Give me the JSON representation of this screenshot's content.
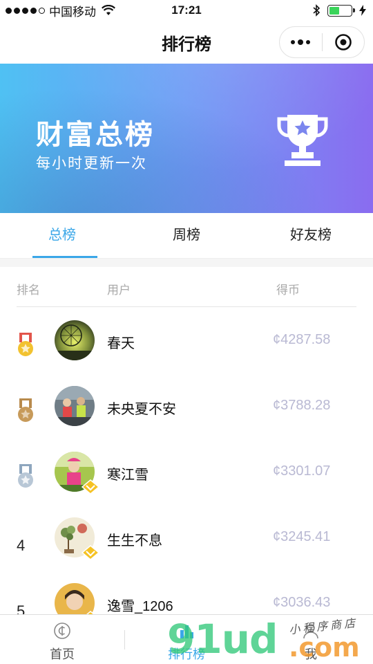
{
  "status_bar": {
    "carrier": "中国移动",
    "time": "17:21",
    "battery_level": 0.45
  },
  "nav": {
    "title": "排行榜"
  },
  "banner": {
    "title": "财富总榜",
    "subtitle": "每小时更新一次",
    "icon": "trophy-icon"
  },
  "tabs": [
    {
      "label": "总榜",
      "active": true
    },
    {
      "label": "周榜",
      "active": false
    },
    {
      "label": "好友榜",
      "active": false
    }
  ],
  "table": {
    "headers": {
      "rank": "排名",
      "user": "用户",
      "coins": "得币"
    },
    "rows": [
      {
        "rank": "1",
        "medal": "gold",
        "name": "春天",
        "coins": "¢4287.58",
        "vip": false
      },
      {
        "rank": "2",
        "medal": "bronze",
        "name": "未央夏不安",
        "coins": "¢3788.28",
        "vip": false
      },
      {
        "rank": "3",
        "medal": "silver",
        "name": "寒江雪",
        "coins": "¢3301.07",
        "vip": true
      },
      {
        "rank": "4",
        "medal": "",
        "name": "生生不息",
        "coins": "¢3245.41",
        "vip": true
      },
      {
        "rank": "5",
        "medal": "",
        "name": "逸雪_1206",
        "coins": "¢3036.43",
        "vip": true
      }
    ]
  },
  "tabbar": {
    "items": [
      {
        "label": "首页",
        "icon": "coin-icon",
        "active": false
      },
      {
        "label": "排行榜",
        "icon": "ranking-icon",
        "active": true
      },
      {
        "label": "我",
        "icon": "user-icon",
        "active": false
      }
    ]
  },
  "watermark": {
    "main": "91ud",
    "domain": ".com",
    "tagline": "小程序商店"
  },
  "colors": {
    "accent": "#3aa7e8",
    "banner_start": "#4fc1f3",
    "banner_end": "#8a6cf0",
    "coins": "#b9b9d3",
    "medal_gold": "#f2c230",
    "medal_bronze": "#c79a5a",
    "medal_silver": "#9fb3c8",
    "vip_badge": "#f5c223"
  }
}
